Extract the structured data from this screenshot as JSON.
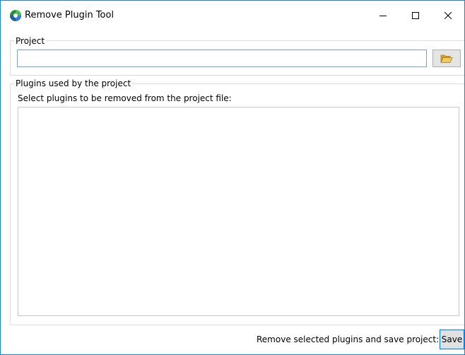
{
  "window": {
    "title": "Remove Plugin Tool"
  },
  "project": {
    "legend": "Project",
    "path_value": "",
    "browse_icon": "folder-open-icon"
  },
  "plugins": {
    "legend": "Plugins used by the project",
    "instruction": "Select plugins to be removed from the project file:",
    "items": []
  },
  "footer": {
    "label": "Remove selected plugins and save project:",
    "save_label": "Save"
  },
  "colors": {
    "window_border": "#1883d7",
    "input_border": "#7a9fd0",
    "button_focus_border": "#0078d7"
  }
}
